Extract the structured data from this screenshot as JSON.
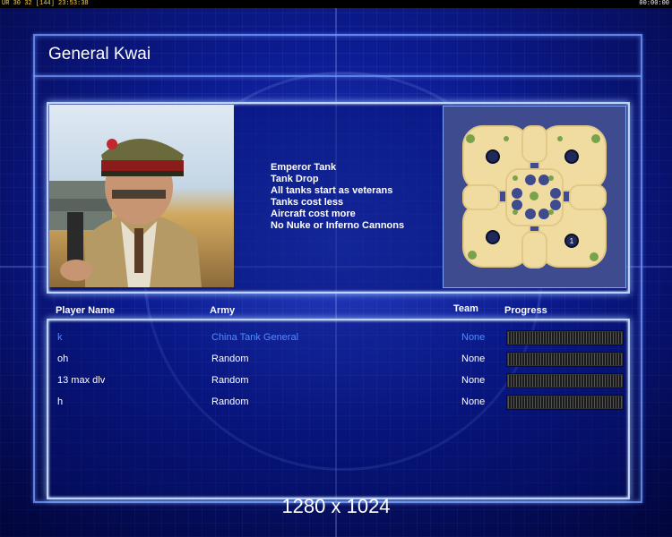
{
  "statusbar": {
    "left": "UR 30 32 [144] 23:53:38",
    "right": "00:00:00"
  },
  "general": {
    "name": "General Kwai",
    "perks": [
      "Emperor Tank",
      "Tank Drop",
      "All tanks start as veterans",
      "Tanks cost less",
      "Aircraft cost more",
      "No Nuke or Inferno Cannons"
    ]
  },
  "map": {
    "player_marker": "1"
  },
  "columns": {
    "player": "Player Name",
    "army": "Army",
    "team": "Team",
    "progress": "Progress"
  },
  "players": [
    {
      "name": "k",
      "army": "China Tank General",
      "team": "None",
      "progress": 0,
      "local": true
    },
    {
      "name": "oh",
      "army": "Random",
      "team": "None",
      "progress": 0,
      "local": false
    },
    {
      "name": "13 max dlv",
      "army": "Random",
      "team": "None",
      "progress": 0,
      "local": false
    },
    {
      "name": "h",
      "army": "Random",
      "team": "None",
      "progress": 0,
      "local": false
    }
  ],
  "resolution": "1280 x 1024",
  "colors": {
    "local_player": "#4f8cff",
    "frame": "#b9d3ff",
    "background": "#0a1a8a"
  }
}
